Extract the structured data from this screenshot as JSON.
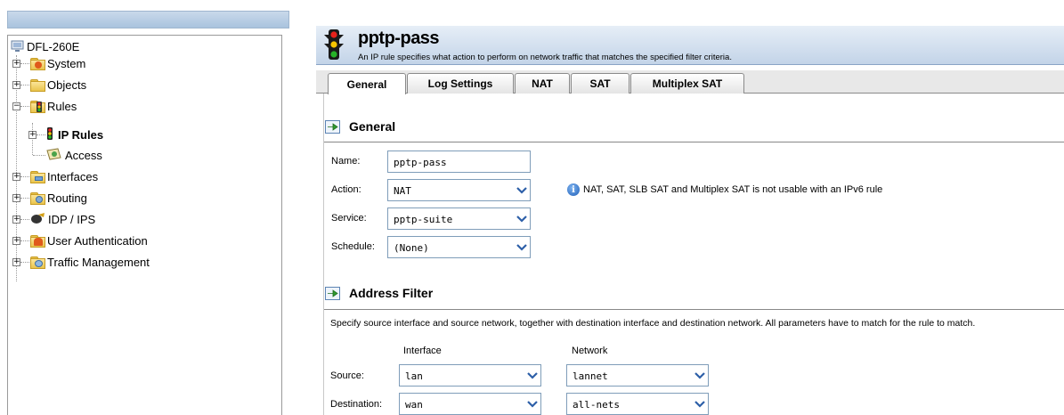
{
  "tree": {
    "root": "DFL-260E",
    "items": [
      {
        "label": "System"
      },
      {
        "label": "Objects"
      },
      {
        "label": "Rules"
      },
      {
        "label": "IP Rules"
      },
      {
        "label": "Access"
      },
      {
        "label": "Interfaces"
      },
      {
        "label": "Routing"
      },
      {
        "label": "IDP / IPS"
      },
      {
        "label": "User Authentication"
      },
      {
        "label": "Traffic Management"
      }
    ]
  },
  "header": {
    "title": "pptp-pass",
    "subtitle": "An IP rule specifies what action to perform on network traffic that matches the specified filter criteria."
  },
  "tabs": [
    {
      "label": "General",
      "active": true
    },
    {
      "label": "Log Settings"
    },
    {
      "label": "NAT"
    },
    {
      "label": "SAT"
    },
    {
      "label": "Multiplex SAT"
    }
  ],
  "general": {
    "heading": "General",
    "name_label": "Name:",
    "name_value": "pptp-pass",
    "action_label": "Action:",
    "action_value": "NAT",
    "service_label": "Service:",
    "service_value": "pptp-suite",
    "schedule_label": "Schedule:",
    "schedule_value": "(None)",
    "note": "NAT, SAT, SLB SAT and Multiplex SAT is not usable with an IPv6 rule"
  },
  "address_filter": {
    "heading": "Address Filter",
    "description": "Specify source interface and source network, together with destination interface and destination network. All parameters have to match for the rule to match.",
    "interface_header": "Interface",
    "network_header": "Network",
    "source_label": "Source:",
    "source_interface": "lan",
    "source_network": "lannet",
    "destination_label": "Destination:",
    "destination_interface": "wan",
    "destination_network": "all-nets"
  },
  "colors": {
    "title_bar": "#c3d4e8",
    "tab_border": "#8a8a8a",
    "field_border": "#7f9db9"
  }
}
